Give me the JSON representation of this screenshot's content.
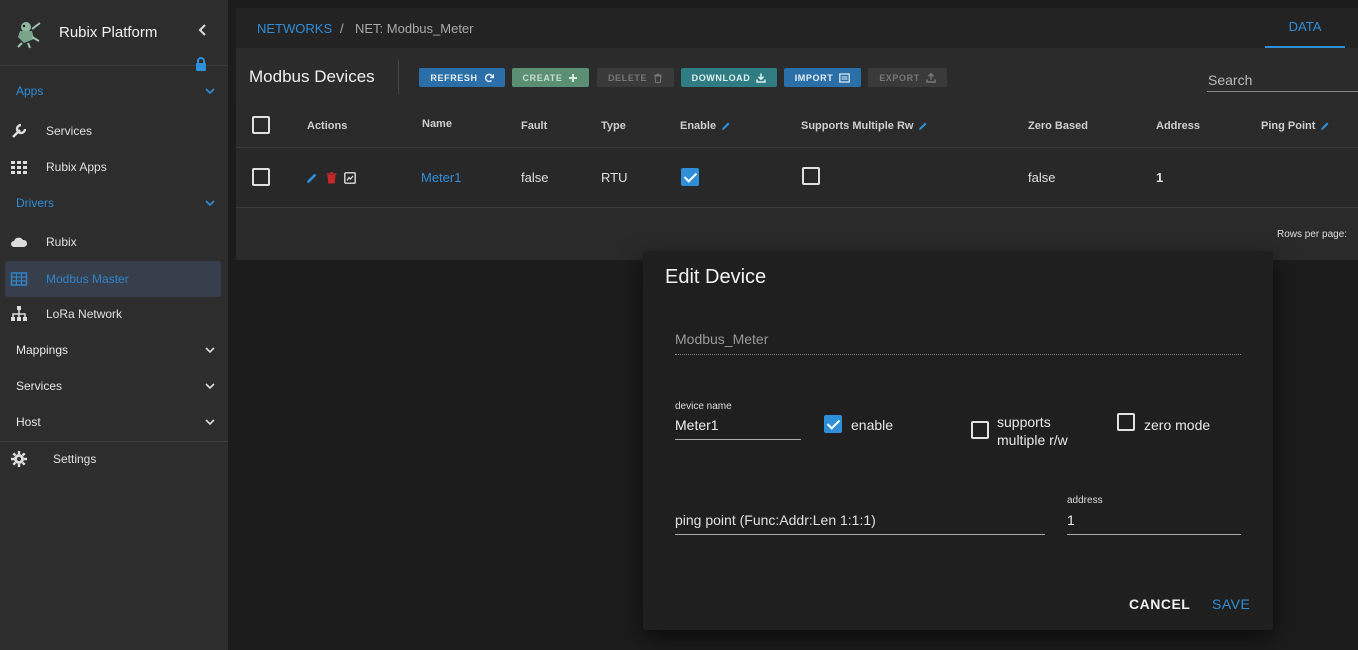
{
  "sidebar": {
    "brand_title": "Rubix Platform",
    "sections": {
      "apps": "Apps",
      "drivers": "Drivers",
      "mappings": "Mappings",
      "services": "Services",
      "host": "Host"
    },
    "items": {
      "services": "Services",
      "rubix_apps": "Rubix Apps",
      "rubix": "Rubix",
      "modbus_master": "Modbus Master",
      "lora_network": "LoRa Network",
      "settings": "Settings"
    }
  },
  "breadcrumb": {
    "root": "NETWORKS",
    "separator": "/",
    "current": "NET: Modbus_Meter"
  },
  "tabs": {
    "data": "DATA"
  },
  "devices": {
    "title": "Modbus Devices",
    "toolbar": {
      "refresh": "REFRESH",
      "create": "CREATE",
      "delete": "DELETE",
      "download": "DOWNLOAD",
      "import": "IMPORT",
      "export": "EXPORT"
    },
    "search_placeholder": "Search",
    "columns": {
      "actions": "Actions",
      "name": "Name",
      "fault": "Fault",
      "type": "Type",
      "enable": "Enable",
      "supports_multiple_rw": "Supports Multiple Rw",
      "zero_based": "Zero Based",
      "address": "Address",
      "ping_point": "Ping Point"
    },
    "rows": [
      {
        "name": "Meter1",
        "fault": "false",
        "type": "RTU",
        "enable": true,
        "supports_multiple_rw": false,
        "zero_based": "false",
        "address": "1"
      }
    ],
    "rows_per_page_label": "Rows per page:"
  },
  "dialog": {
    "title": "Edit Device",
    "network_value": "Modbus_Meter",
    "device_name_label": "device name",
    "device_name_value": "Meter1",
    "enable_label": "enable",
    "enable_checked": true,
    "supports_label_line1": "supports",
    "supports_label_line2": "multiple r/w",
    "supports_checked": false,
    "zero_mode_label": "zero mode",
    "zero_mode_checked": false,
    "ping_point_placeholder": "ping point (Func:Addr:Len 1:1:1)",
    "address_label": "address",
    "address_value": "1",
    "cancel_label": "CANCEL",
    "save_label": "SAVE"
  },
  "colors": {
    "accent": "#2f8ed8",
    "delete_icon": "#c62828",
    "sidebar_bg": "#2d2d2d"
  }
}
